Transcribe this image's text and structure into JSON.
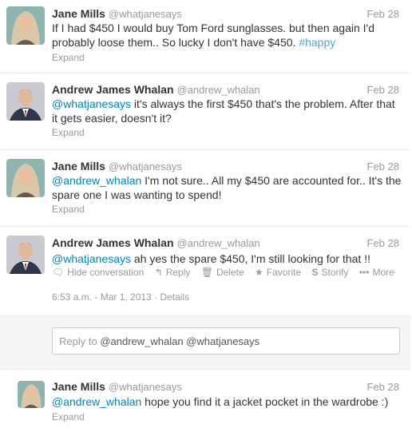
{
  "tweets": [
    {
      "name": "Jane Mills",
      "handle": "@whatjanesays",
      "date": "Feb 28",
      "text_a": "If I had $450 I would buy Tom Ford sunglasses. but then again I'd probably loose them.. So lucky I don't have $450. ",
      "hashtag": "#happy",
      "expand": "Expand"
    },
    {
      "name": "Andrew James Whalan",
      "handle": "@andrew_whalan",
      "date": "Feb 28",
      "mention": "@whatjanesays",
      "text": " it's always the first $450 that's the problem. After that it gets easier, doesn't it?",
      "expand": "Expand"
    },
    {
      "name": "Jane Mills",
      "handle": "@whatjanesays",
      "date": "Feb 28",
      "mention": "@andrew_whalan",
      "text": " I'm not sure.. All my $450 are accounted for.. It's the spare one I was wanting to spend!",
      "expand": "Expand"
    },
    {
      "name": "Andrew James Whalan",
      "handle": "@andrew_whalan",
      "date": "Feb 28",
      "mention": "@whatjanesays",
      "text": " ah yes the spare $450, I'm still looking for that !!",
      "actions": {
        "hide": "Hide conversation",
        "reply": "Reply",
        "delete": "Delete",
        "favorite": "Favorite",
        "storify": "Storify",
        "more": "More"
      },
      "timestamp": "6:53 a.m. - Mar 1, 2013 · Details"
    },
    {
      "name": "Jane Mills",
      "handle": "@whatjanesays",
      "date": "Feb 28",
      "mention": "@andrew_whalan",
      "text": " hope you find it a jacket pocket in the wardrobe :)",
      "expand": "Expand"
    }
  ],
  "reply_box": {
    "prefix": "Reply to ",
    "mentions": "@andrew_whalan @whatjanesays"
  },
  "colors": {
    "link": "#0084b4",
    "muted": "#999999"
  }
}
